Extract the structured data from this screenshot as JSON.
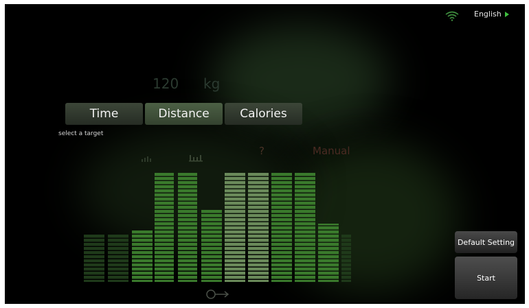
{
  "topbar": {
    "language_label": "English",
    "wifi_icon": "wifi-icon",
    "language_arrow_icon": "play-triangle-icon"
  },
  "profile": {
    "weight_value": "120",
    "weight_unit": "kg"
  },
  "targets": {
    "time_label": "Time",
    "distance_label": "Distance",
    "calories_label": "Calories",
    "hint": "select a target"
  },
  "programs": {
    "random_label": "?",
    "manual_label": "Manual",
    "icons": [
      "bars-small-icon",
      "bars-grid-icon"
    ]
  },
  "actions": {
    "default_setting_label": "Default Setting",
    "start_label": "Start"
  },
  "colors": {
    "accent_green": "#3fbf3f",
    "bar_green": "#3f8a2e",
    "background": "#000000"
  }
}
